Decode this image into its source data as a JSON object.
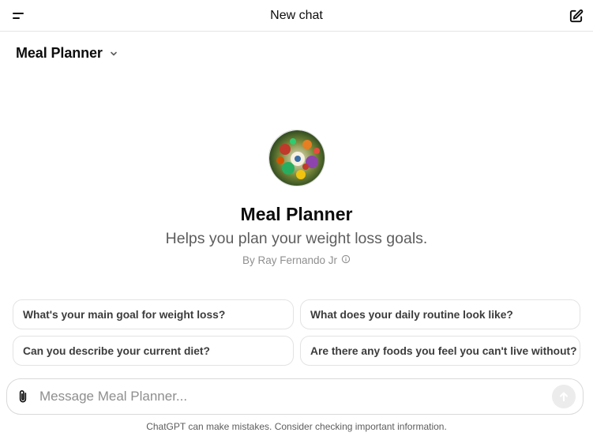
{
  "header": {
    "title": "New chat",
    "menu_icon": "menu-icon",
    "new_chat_icon": "compose-icon"
  },
  "model_selector": {
    "label": "Meal Planner",
    "icon": "chevron-down-icon"
  },
  "gpt": {
    "name": "Meal Planner",
    "description": "Helps you plan your weight loss goals.",
    "author": "By Ray Fernando Jr",
    "info_icon": "info-icon"
  },
  "starters": [
    {
      "label": "What's your main goal for weight loss?"
    },
    {
      "label": "What does your daily routine look like?"
    },
    {
      "label": "Can you describe your current diet?"
    },
    {
      "label": "Are there any foods you feel you can't live without?"
    }
  ],
  "composer": {
    "placeholder": "Message Meal Planner...",
    "value": "",
    "attach_icon": "paperclip-icon",
    "send_icon": "arrow-up-icon"
  },
  "footer": {
    "disclaimer": "ChatGPT can make mistakes. Consider checking important information."
  },
  "colors": {
    "text": "#0d0d0d",
    "muted": "#5d5d5d",
    "border": "#e3e3e3",
    "send_bg": "#ececec"
  }
}
